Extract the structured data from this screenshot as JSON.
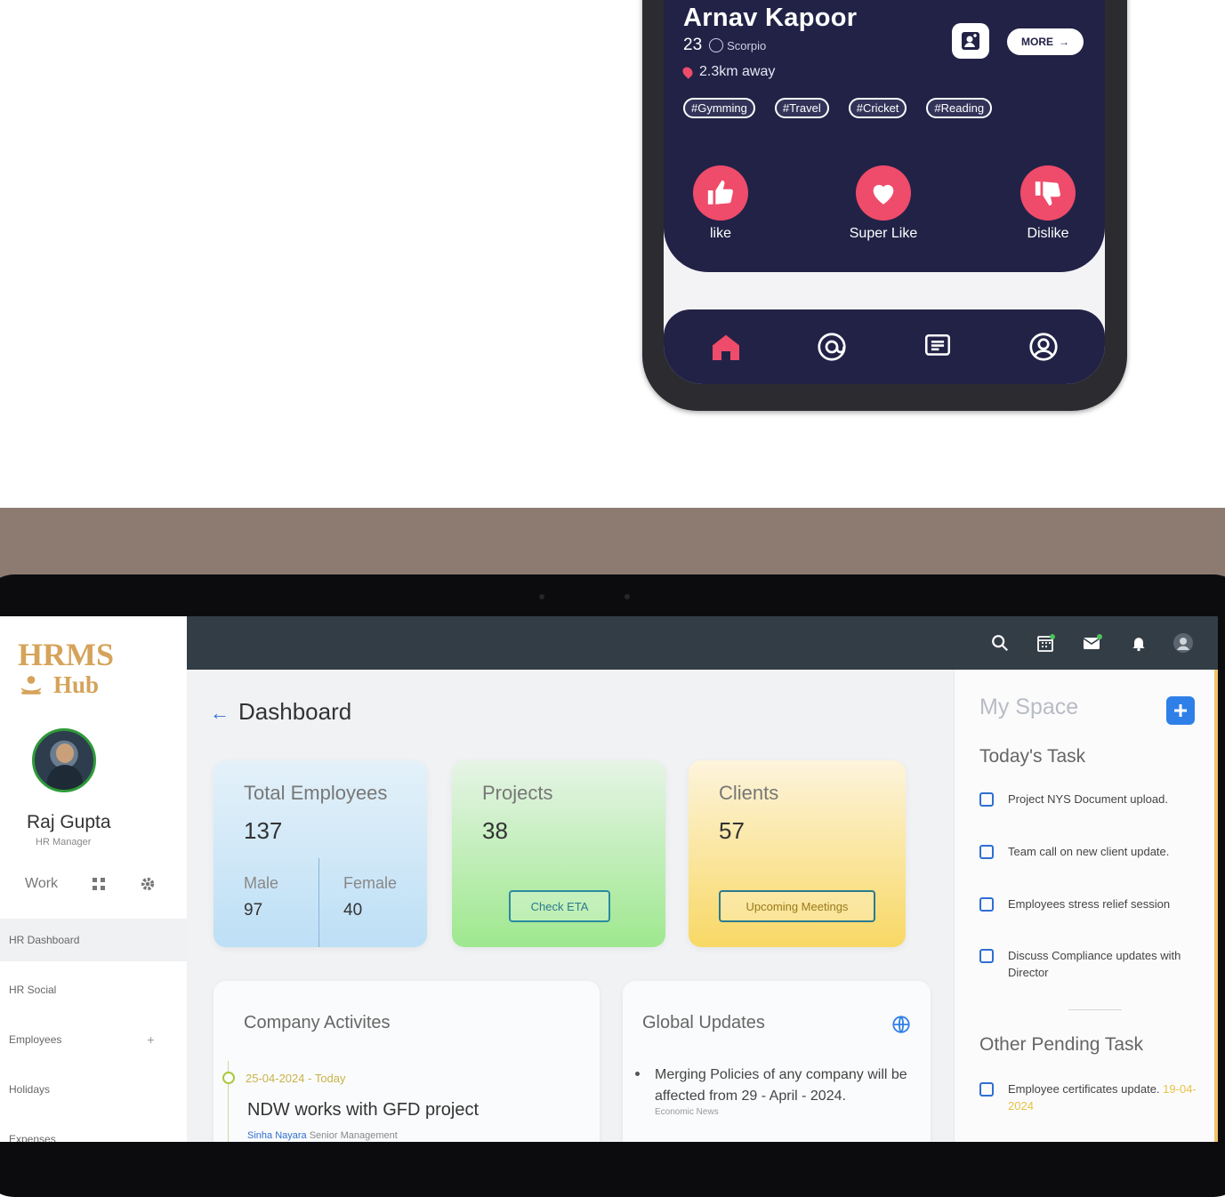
{
  "phone": {
    "name": "Arnav Kapoor",
    "age": "23",
    "zodiac": "Scorpio",
    "distance": "2.3km away",
    "more_label": "MORE",
    "tags": [
      "#Gymming",
      "#Travel",
      "#Cricket",
      "#Reading"
    ],
    "reactions": [
      {
        "label": "like",
        "icon": "thumbs-up-icon"
      },
      {
        "label": "Super Like",
        "icon": "heart-icon"
      },
      {
        "label": "Dislike",
        "icon": "thumbs-down-icon"
      }
    ],
    "nav_icons": [
      "home-icon",
      "at-icon",
      "chat-icon",
      "profile-icon"
    ],
    "accent_color": "#ef4b6a",
    "card_color": "#222247"
  },
  "tablet": {
    "logo_line1": "HRMS",
    "logo_line2": "Hub",
    "user_name": "Raj Gupta",
    "user_role": "HR Manager",
    "work_label": "Work",
    "sidebar_items": [
      "HR Dashboard",
      "HR Social",
      "Employees",
      "Holidays",
      "Expenses"
    ],
    "page_title": "Dashboard",
    "stats": {
      "employees": {
        "label": "Total Employees",
        "value": "137",
        "male_label": "Male",
        "male_value": "97",
        "female_label": "Female",
        "female_value": "40"
      },
      "projects": {
        "label": "Projects",
        "value": "38",
        "button": "Check ETA"
      },
      "clients": {
        "label": "Clients",
        "value": "57",
        "button": "Upcoming Meetings"
      }
    },
    "activities": {
      "title": "Company Activites",
      "date": "25-04-2024 - Today",
      "headline": "NDW works with GFD project",
      "author": "Sinha Nayara",
      "author_role": "Senior Management"
    },
    "global_updates": {
      "title": "Global Updates",
      "text": "Merging Policies of any company will be affected from 29 - April - 2024.",
      "source": "Economic News"
    },
    "my_space": {
      "title": "My Space",
      "todays_task_title": "Today's Task",
      "todays_tasks": [
        "Project NYS Document upload.",
        "Team call on new client update.",
        "Employees stress relief session",
        "Discuss Compliance updates with Director"
      ],
      "other_title": "Other Pending Task",
      "other_tasks": [
        {
          "text": "Employee certificates update.",
          "date": "19-04-2024"
        }
      ]
    },
    "topbar_icons": [
      "search-icon",
      "calendar-icon",
      "mail-icon",
      "bell-icon",
      "user-avatar-icon"
    ]
  }
}
